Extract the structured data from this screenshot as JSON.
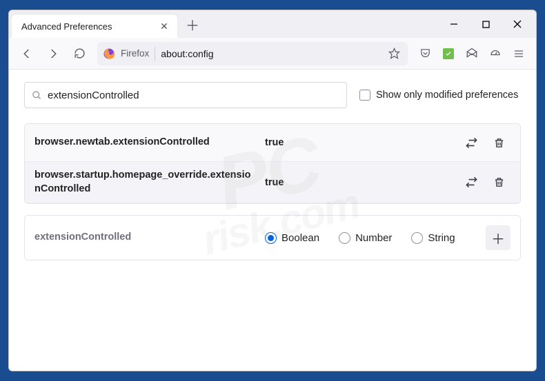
{
  "tab": {
    "title": "Advanced Preferences"
  },
  "addressbar": {
    "label": "Firefox",
    "url": "about:config"
  },
  "search": {
    "value": "extensionControlled",
    "checkbox_label": "Show only modified preferences"
  },
  "prefs": [
    {
      "name": "browser.newtab.extensionControlled",
      "value": "true"
    },
    {
      "name": "browser.startup.homepage_override.extensionControlled",
      "value": "true"
    }
  ],
  "newpref": {
    "name": "extensionControlled",
    "types": [
      "Boolean",
      "Number",
      "String"
    ],
    "selected": 0
  }
}
